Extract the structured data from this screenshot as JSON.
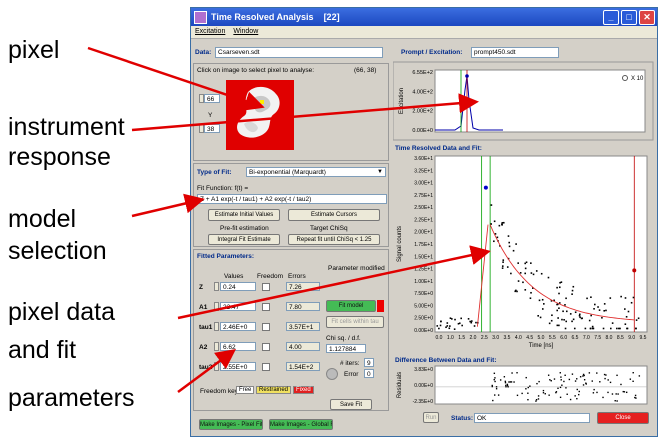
{
  "callouts": [
    "pixel",
    "instrument",
    "response",
    "model",
    "selection",
    "pixel data",
    "and fit",
    "parameters"
  ],
  "window": {
    "title": "Time Resolved Analysis",
    "title_suffix": "[22]",
    "menu": [
      "Excitation",
      "Window"
    ]
  },
  "data_row": {
    "label": "Data:",
    "value": "Csarseven.sdt"
  },
  "prompt_row": {
    "label": "Prompt / Excitation:",
    "value": "prompt450.sdt"
  },
  "image_panel": {
    "instruction": "Click on image to select pixel to analyse:",
    "coords": "(66, 38)",
    "x_value": "66",
    "y_label": "Y",
    "y_value": "38"
  },
  "fit_type": {
    "label": "Type of Fit:",
    "value": "Bi-exponential (Marquardt)"
  },
  "fit_function": {
    "label": "Fit Function: f(t) =",
    "formula": "Z + A1 exp(-t / tau1) + A2 exp(-t / tau2)",
    "btn_initial": "Estimate Initial Values",
    "btn_cursors": "Estimate Cursors",
    "prefit_label": "Pre-fit estimation",
    "prefit_value": "Integral Fit Estimate",
    "target_label": "Target ChiSq",
    "target_value": "Repeat fit until ChiSq < 1.25"
  },
  "fitted": {
    "title": "Fitted Parameters:",
    "col_values": "Values",
    "col_freedom": "Freedom",
    "col_errors": "Errors",
    "param_modified": "Parameter modified",
    "rows": [
      {
        "name": "Z",
        "value": "0.24",
        "error": "7.26"
      },
      {
        "name": "A1",
        "value": "22.47",
        "error": "7.80"
      },
      {
        "name": "tau1",
        "value": "2.46E+0",
        "error": "3.57E+1"
      },
      {
        "name": "A2",
        "value": "6.62",
        "error": "4.00"
      },
      {
        "name": "tau2",
        "value": "2.55E+0",
        "error": "1.54E+2"
      }
    ],
    "btn_fit_model": "Fit model",
    "btn_fit_cells": "Fit cells within tau",
    "chisq_label": "Chi sq. / d.f.",
    "chisq_value": "1.127884",
    "iters_label": "# iters:",
    "iters_value": "9",
    "error_label": "Error",
    "error_value": "0",
    "freedom_key_label": "Freedom key:",
    "key_free": "Free",
    "key_restrained": "Restrained",
    "key_fixed": "Fixed",
    "save_fit": "Save Fit"
  },
  "bottom": {
    "btn_pixel_fits": "Make Images - Pixel Fits",
    "btn_global_fit": "Make Images - Global Fit",
    "btn_run": "Run",
    "status_label": "Status:",
    "status_value": "OK",
    "close": "Close"
  },
  "excitation_plot": {
    "ylabel": "Excitation",
    "yticks": [
      "6.55E+2",
      "4.00E+2",
      "2.00E+2",
      "0.00E+0"
    ],
    "x10_label": "X 10"
  },
  "decay_plot": {
    "title": "Time Resolved Data and Fit:",
    "scale_label": "lin",
    "ylabel": "Signal counts",
    "xlabel": "Time [ns]",
    "yticks": [
      "3.60E+1",
      "3.25E+1",
      "3.00E+1",
      "2.75E+1",
      "2.50E+1",
      "2.25E+1",
      "2.00E+1",
      "1.75E+1",
      "1.50E+1",
      "1.25E+1",
      "1.00E+1",
      "7.50E+0",
      "5.00E+0",
      "2.50E+0",
      "0.00E+0"
    ],
    "xticks": [
      "0.0",
      "1.0",
      "1.5",
      "2.0",
      "2.5",
      "3.0",
      "3.5",
      "4.0",
      "4.5",
      "5.0",
      "5.5",
      "6.0",
      "6.5",
      "7.0",
      "7.5",
      "8.0",
      "8.5",
      "9.0",
      "9.5"
    ]
  },
  "residuals_plot": {
    "title": "Difference Between Data and Fit:",
    "ylabel": "Residuals",
    "yticks": [
      "3.83E+0",
      "0.00E+0",
      "-2.35E+0"
    ]
  },
  "colors": {
    "arrow": "#e00000",
    "fit_curve": "#e03030",
    "cursor_green": "#00a000",
    "cursor_red": "#c00000",
    "data_point": "#000000"
  }
}
